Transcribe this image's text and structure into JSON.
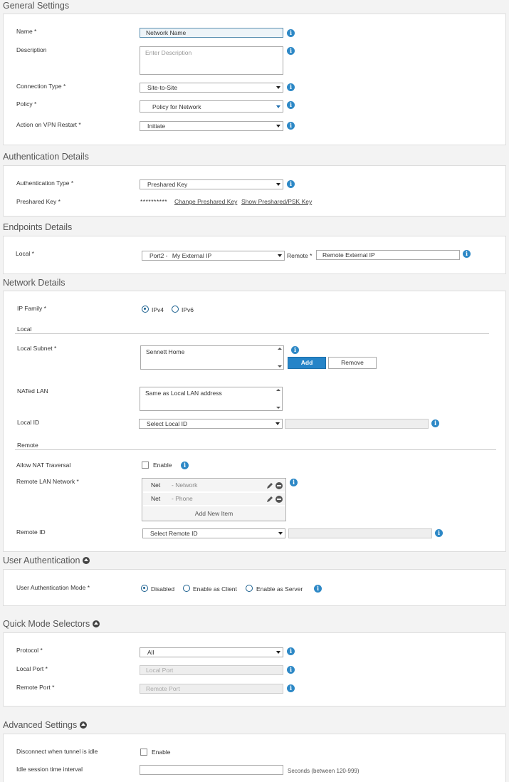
{
  "general": {
    "title": "General Settings",
    "name_label": "Name *",
    "name_value": "Network Name",
    "description_label": "Description",
    "description_placeholder": "Enter Description",
    "connection_type_label": "Connection Type *",
    "connection_type_value": "Site-to-Site",
    "policy_label": "Policy *",
    "policy_value": "Policy for Network",
    "action_label": "Action on VPN Restart *",
    "action_value": "Initiate"
  },
  "auth": {
    "title": "Authentication Details",
    "type_label": "Authentication Type *",
    "type_value": "Preshared Key",
    "key_label": "Preshared Key *",
    "key_mask": "**********",
    "change_link": "Change Preshared Key",
    "show_link": "Show Preshared/PSK Key"
  },
  "endpoints": {
    "title": "Endpoints Details",
    "local_label": "Local *",
    "local_port": "Port2 -",
    "local_value": "My External IP",
    "remote_label": "Remote *",
    "remote_value": "Remote External IP"
  },
  "network": {
    "title": "Network Details",
    "ip_family_label": "IP Family *",
    "ipv4": "IPv4",
    "ipv6": "IPv6",
    "local_heading": "Local",
    "local_subnet_label": "Local Subnet *",
    "local_subnet_value": "Sennett Home",
    "add_button": "Add",
    "remove_button": "Remove",
    "nated_lan_label": "NATed LAN",
    "nated_lan_value": "Same as Local LAN address",
    "local_id_label": "Local ID",
    "local_id_value": "Select Local ID",
    "remote_heading": "Remote",
    "nat_traversal_label": "Allow NAT Traversal",
    "nat_traversal_enable": "Enable",
    "remote_lan_label": "Remote LAN Network *",
    "remote_lan_items": [
      {
        "name": "Net",
        "desc": "- Network"
      },
      {
        "name": "Net",
        "desc": "- Phone"
      }
    ],
    "add_new_item": "Add New Item",
    "remote_id_label": "Remote ID",
    "remote_id_value": "Select Remote ID"
  },
  "user_auth": {
    "title": "User Authentication",
    "mode_label": "User Authentication Mode *",
    "disabled": "Disabled",
    "as_client": "Enable as Client",
    "as_server": "Enable as Server"
  },
  "quick_mode": {
    "title": "Quick Mode Selectors",
    "protocol_label": "Protocol *",
    "protocol_value": "All",
    "local_port_label": "Local Port *",
    "local_port_placeholder": "Local Port",
    "remote_port_label": "Remote Port *",
    "remote_port_placeholder": "Remote Port"
  },
  "advanced": {
    "title": "Advanced Settings",
    "disconnect_label": "Disconnect when tunnel is idle",
    "disconnect_enable": "Enable",
    "idle_label": "Idle session time interval",
    "idle_hint": "Seconds (between 120-999)"
  },
  "info_glyph": "i",
  "icons": [
    "info-icon",
    "pencil-icon",
    "minus-circle-icon",
    "caret-up-icon",
    "dropdown-arrow-icon"
  ],
  "colors": {
    "accent": "#2584c8",
    "info": "#2d88c6"
  }
}
